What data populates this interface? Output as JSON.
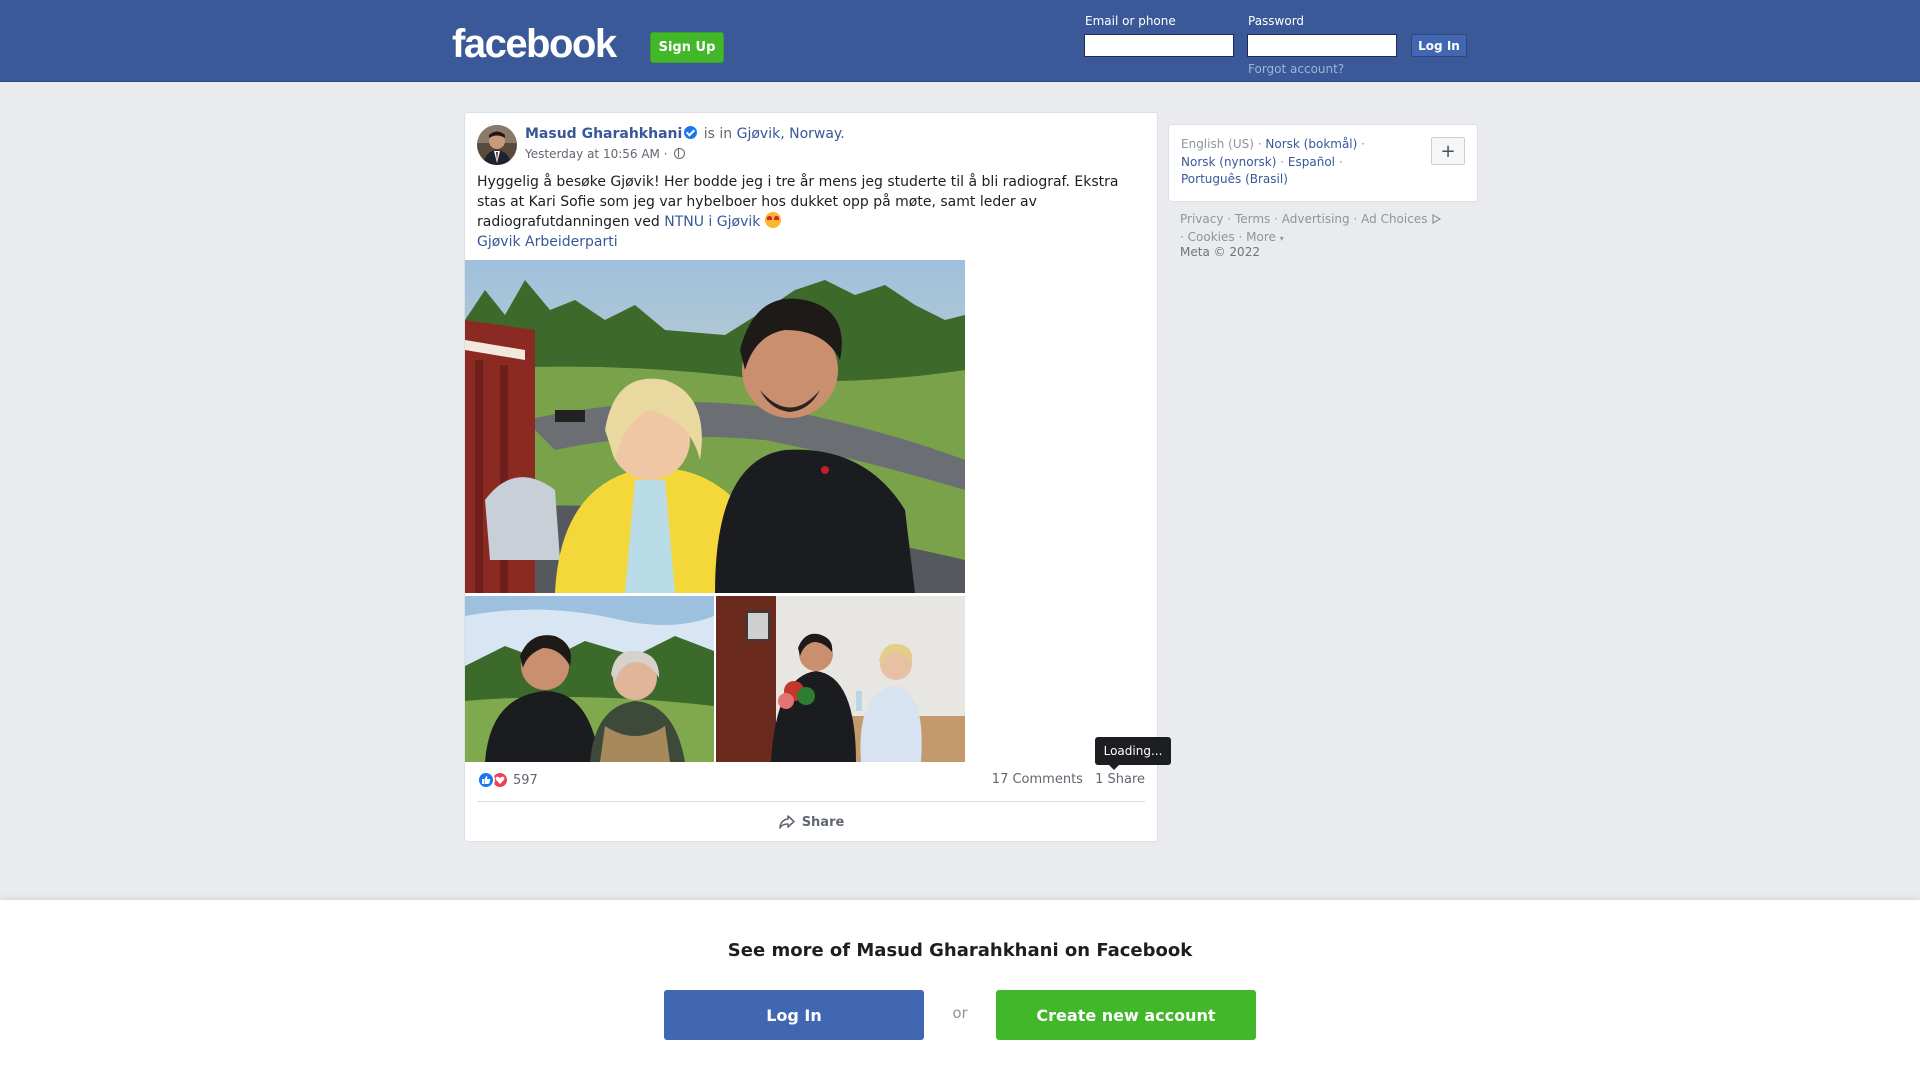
{
  "header": {
    "logo_text": "facebook",
    "signup_label": "Sign Up",
    "email_label": "Email or phone",
    "email_value": "",
    "password_label": "Password",
    "password_value": "",
    "login_label": "Log In",
    "forgot_label": "Forgot account?"
  },
  "post": {
    "author": "Masud Gharahkhani",
    "verified_icon": "verified-badge-icon",
    "is_in": "is in",
    "location": "Gjøvik, Norway.",
    "time": "Yesterday at 10:56 AM",
    "separator": "·",
    "privacy_icon": "globe-icon",
    "text_main": "Hyggelig å besøke Gjøvik! Her bodde jeg i tre år mens jeg studerte til å bli radiograf. Ekstra stas at Kari Sofie som jeg var hybelboer hos dukket opp på møte, samt leder av radiografutdanningen ved",
    "text_link": "NTNU i Gjøvik",
    "text_emoji": "heart-eyes-emoji",
    "text_tag": "Gjøvik Arbeiderparti",
    "reaction_icons": [
      "like-reaction-icon",
      "love-reaction-icon"
    ],
    "reaction_count": "597",
    "comments": "17 Comments",
    "shares": "1 Share",
    "tooltip": "Loading...",
    "share_label": "Share"
  },
  "sidebar": {
    "languages": {
      "current": "English (US)",
      "options": [
        "Norsk (bokmål)",
        "Norsk (nynorsk)",
        "Español",
        "Português (Brasil)"
      ],
      "separator": "·",
      "add_label": "+"
    },
    "footer": {
      "links": [
        "Privacy",
        "Terms",
        "Advertising",
        "Ad Choices",
        "Cookies",
        "More"
      ],
      "copyright": "Meta © 2022"
    }
  },
  "banner": {
    "title": "See more of Masud Gharahkhani on Facebook",
    "login_label": "Log In",
    "or_label": "or",
    "create_label": "Create new account"
  },
  "colors": {
    "brand_blue": "#3b5998",
    "button_blue": "#4267b2",
    "green": "#42b72a",
    "link": "#385898"
  }
}
